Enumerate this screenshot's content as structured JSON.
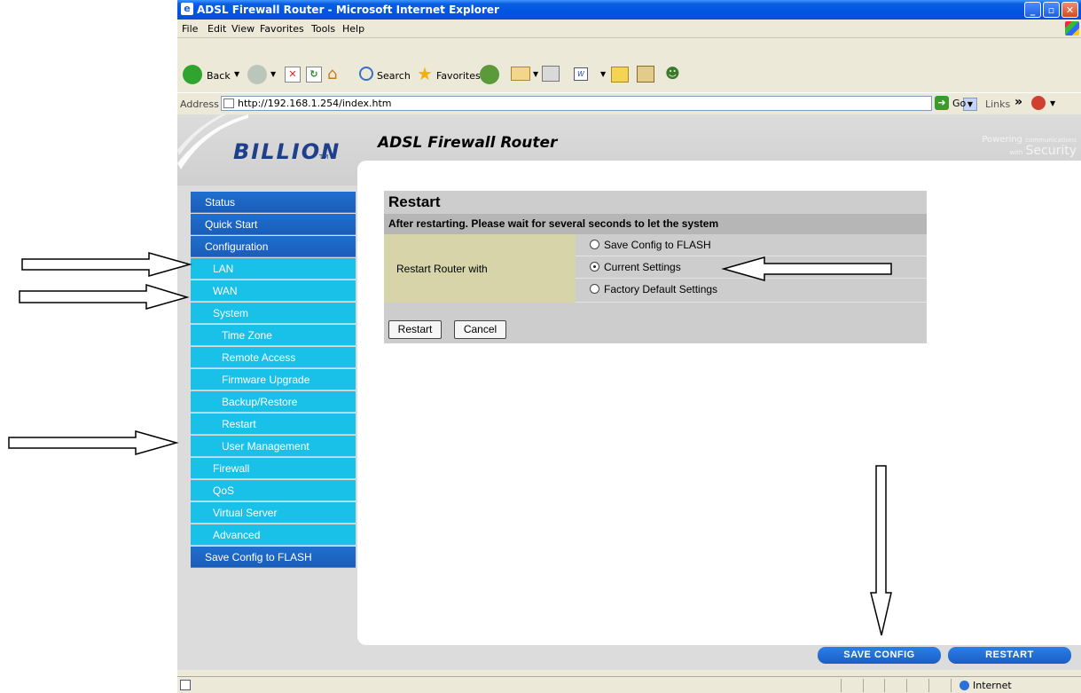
{
  "window": {
    "title": "ADSL Firewall Router - Microsoft Internet Explorer"
  },
  "menu": [
    "File",
    "Edit",
    "View",
    "Favorites",
    "Tools",
    "Help"
  ],
  "toolbar": {
    "back": "Back",
    "search": "Search",
    "favorites": "Favorites"
  },
  "address": {
    "label": "Address",
    "url": "http://192.168.1.254/index.htm",
    "go": "Go",
    "links": "Links"
  },
  "header": {
    "logo": "BILLION",
    "logo_tm": "TM",
    "product": "ADSL Firewall Router",
    "tagline_small1": "Powering",
    "tagline_small2": "communications",
    "tagline_small3": "with",
    "tagline_big": "Security"
  },
  "sidebar": [
    {
      "label": "Status",
      "level": 1
    },
    {
      "label": "Quick Start",
      "level": 1
    },
    {
      "label": "Configuration",
      "level": 1
    },
    {
      "label": "LAN",
      "level": 2
    },
    {
      "label": "WAN",
      "level": 2
    },
    {
      "label": "System",
      "level": 2
    },
    {
      "label": "Time Zone",
      "level": 3
    },
    {
      "label": "Remote Access",
      "level": 3
    },
    {
      "label": "Firmware Upgrade",
      "level": 3
    },
    {
      "label": "Backup/Restore",
      "level": 3
    },
    {
      "label": "Restart",
      "level": 3
    },
    {
      "label": "User Management",
      "level": 3
    },
    {
      "label": "Firewall",
      "level": 2
    },
    {
      "label": "QoS",
      "level": 2
    },
    {
      "label": "Virtual Server",
      "level": 2
    },
    {
      "label": "Advanced",
      "level": 2
    },
    {
      "label": "Save Config to FLASH",
      "level": 1
    }
  ],
  "panel": {
    "title": "Restart",
    "subtitle": "After restarting. Please wait for several seconds to let the system",
    "field_label": "Restart Router with",
    "options": [
      {
        "label": "Save Config to FLASH",
        "selected": false
      },
      {
        "label": "Current Settings",
        "selected": true
      },
      {
        "label": "Factory Default Settings",
        "selected": false
      }
    ],
    "restart_button": "Restart",
    "cancel_button": "Cancel"
  },
  "footer_buttons": {
    "save_config": "SAVE CONFIG",
    "restart": "RESTART"
  },
  "statusbar": {
    "zone": "Internet"
  },
  "colors": {
    "nav_dark": "#1a5db7",
    "nav_light": "#19c1e9",
    "title_bar": "#0054e3"
  }
}
